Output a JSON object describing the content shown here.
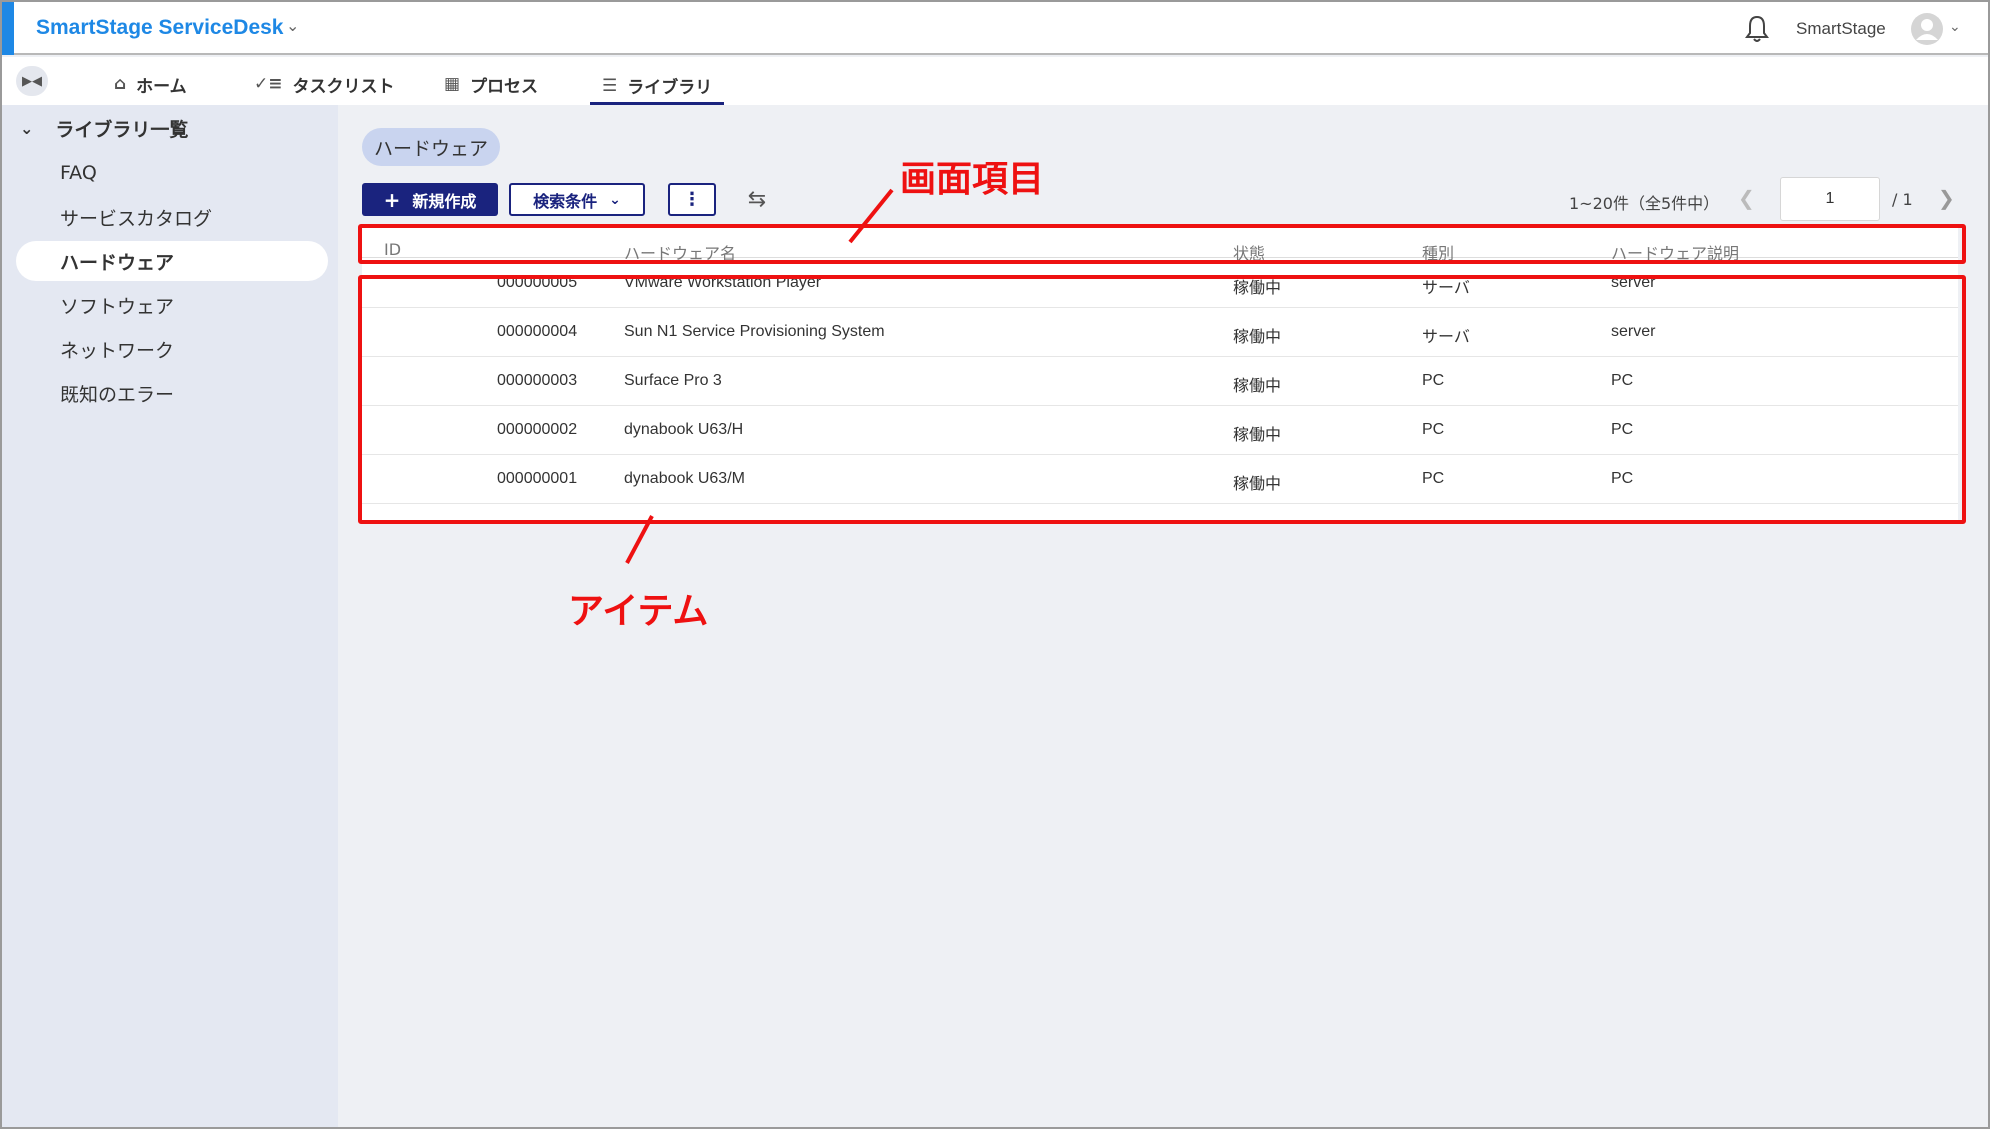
{
  "header": {
    "app_title": "SmartStage ServiceDesk",
    "user_name": "SmartStage"
  },
  "nav": {
    "tabs": [
      {
        "label": "ホーム",
        "icon": "home-icon"
      },
      {
        "label": "タスクリスト",
        "icon": "checklist-icon"
      },
      {
        "label": "プロセス",
        "icon": "process-icon"
      },
      {
        "label": "ライブラリ",
        "icon": "list-icon",
        "active": true
      }
    ]
  },
  "sidebar": {
    "heading": "ライブラリ一覧",
    "items": [
      {
        "label": "FAQ"
      },
      {
        "label": "サービスカタログ"
      },
      {
        "label": "ハードウェア",
        "active": true
      },
      {
        "label": "ソフトウェア"
      },
      {
        "label": "ネットワーク"
      },
      {
        "label": "既知のエラー"
      }
    ]
  },
  "main": {
    "chip_label": "ハードウェア",
    "new_button": "新規作成",
    "search_button": "検索条件",
    "pagination": {
      "info": "1~20件（全5件中）",
      "page": "1",
      "total": "/ 1"
    },
    "table": {
      "headers": [
        "ID",
        "ハードウェア名",
        "状態",
        "種別",
        "ハードウェア説明"
      ],
      "rows": [
        {
          "id": "000000005",
          "name": "VMware Workstation Player",
          "status": "稼働中",
          "type": "サーバ",
          "desc": "server"
        },
        {
          "id": "000000004",
          "name": "Sun N1 Service Provisioning System",
          "status": "稼働中",
          "type": "サーバ",
          "desc": "server"
        },
        {
          "id": "000000003",
          "name": "Surface Pro 3",
          "status": "稼働中",
          "type": "PC",
          "desc": "PC"
        },
        {
          "id": "000000002",
          "name": "dynabook U63/H",
          "status": "稼働中",
          "type": "PC",
          "desc": "PC"
        },
        {
          "id": "000000001",
          "name": "dynabook U63/M",
          "status": "稼働中",
          "type": "PC",
          "desc": "PC"
        }
      ]
    }
  },
  "annotations": {
    "header_label": "画面項目",
    "items_label": "アイテム",
    "color": "#ee1111"
  },
  "colors": {
    "brand": "#1e88e5",
    "primary": "#1a237e",
    "sidebar_bg": "#e4e8f2",
    "chip_bg": "#c9d4ef"
  }
}
